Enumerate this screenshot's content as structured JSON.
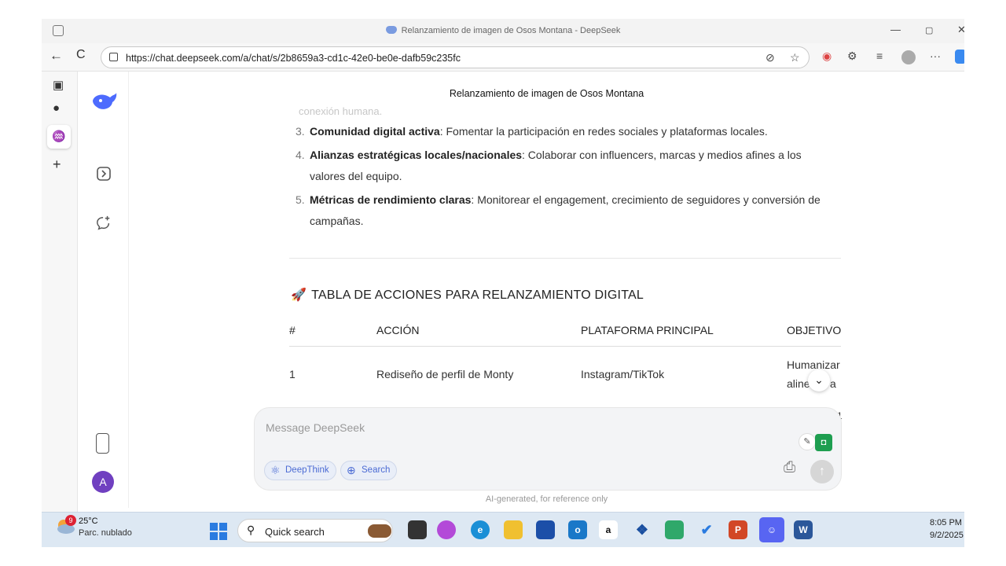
{
  "browser": {
    "window_title": "Relanzamiento de imagen de Osos Montana - DeepSeek",
    "url": "https://chat.deepseek.com/a/chat/s/2b8659a3-cd1c-42e0-be0e-dafb59c235fc",
    "controls": {
      "minimize": "—",
      "restore": "▢",
      "close": "✕"
    },
    "nav": {
      "back": "←",
      "refresh": "C",
      "more": "···"
    }
  },
  "chat": {
    "title": "Relanzamiento de imagen de Osos Montana",
    "faded_text": "conexión humana.",
    "list_items": [
      {
        "num": "3.",
        "bold": "Comunidad digital activa",
        "rest": ": Fomentar la participación en redes sociales y plataformas locales."
      },
      {
        "num": "4.",
        "bold": "Alianzas estratégicas locales/nacionales",
        "rest": ": Colaborar con influencers, marcas y medios afines a los valores del equipo."
      },
      {
        "num": "5.",
        "bold": "Métricas de rendimiento claras",
        "rest": ": Monitorear el engagement, crecimiento de seguidores y conversión de campañas."
      }
    ],
    "section_icon": "🚀",
    "section_heading": "TABLA DE ACCIONES PARA RELANZAMIENTO DIGITAL",
    "table": {
      "headers": [
        "#",
        "ACCIÓN",
        "PLATAFORMA PRINCIPAL",
        "OBJETIVO"
      ],
      "rows": [
        {
          "num": "1",
          "accion": "Rediseño de perfil de Monty",
          "plataforma": "Instagram/TikTok",
          "objetivo_line1": "Humanizar",
          "objetivo_line2": "aline",
          "objetivo_suffix": "a"
        }
      ],
      "next_row_hint": "1"
    }
  },
  "composer": {
    "placeholder": "Message DeepSeek",
    "deepthink_label": "DeepThink",
    "search_label": "Search"
  },
  "disclaimer": "AI-generated, for reference only",
  "user_avatar": "A",
  "taskbar": {
    "weather_badge": "9",
    "temperature": "25°C",
    "condition": "Parc. nublado",
    "search_text": "Quick search",
    "time": "8:05 PM",
    "date": "9/2/2025"
  },
  "colors": {
    "accent": "#4d6bfe",
    "composer_bg": "#f3f4f6",
    "taskbar_bg": "#dde8f3"
  }
}
